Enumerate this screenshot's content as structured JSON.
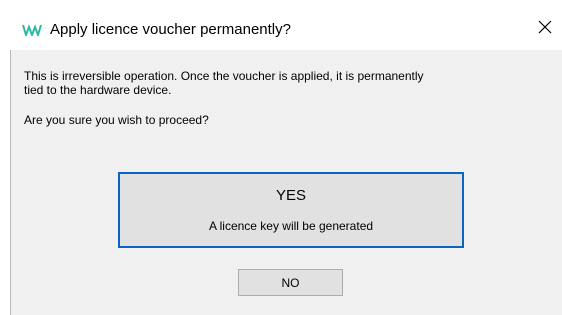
{
  "window": {
    "title": "Apply licence voucher permanently?",
    "logo_icon": "wavelogo-icon",
    "close_icon": "close-icon",
    "accent_color": "#0a64c2",
    "logo_color": "#2fb9a4"
  },
  "message": {
    "line1": "This is irreversible operation. Once the voucher is applied, it is permanently",
    "line2": "tied to the hardware device.",
    "question": "Are you sure you wish to proceed?"
  },
  "buttons": {
    "yes_label": "YES",
    "yes_subtitle": "A licence key will be generated",
    "no_label": "NO"
  }
}
